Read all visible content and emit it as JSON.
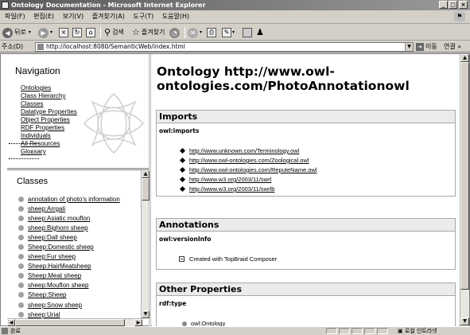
{
  "window": {
    "title": "Ontology Documentation - Microsoft Internet Explorer",
    "controls": [
      "_",
      "□",
      "×"
    ]
  },
  "menu": {
    "items": [
      "파일(F)",
      "편집(E)",
      "보기(V)",
      "즐겨찾기(A)",
      "도구(T)",
      "도움말(H)"
    ]
  },
  "toolbar": {
    "back_label": "뒤로",
    "search_label": "검색",
    "favorites_label": "즐겨찾기"
  },
  "address": {
    "label": "주소(D)",
    "url": "http://localhost:8080/SemanticWeb/index.html",
    "go_label": "이동",
    "links_label": "연결 »"
  },
  "nav": {
    "title": "Navigation",
    "items": [
      "Ontologies",
      "Class Hierarchy",
      "Classes",
      "Datatype Properties",
      "Object Properties",
      "RDF Properties",
      "Individuals",
      "All Resources",
      "Glossary"
    ]
  },
  "classes": {
    "title": "Classes",
    "items": [
      "annotation of photo's information",
      "sheep:Arrgali",
      "sheep:Asiatic mouflon",
      "sheep:Bighorn sheep",
      "sheep:Dall sheep",
      "Sheep:Domestic sheep",
      "sheep:Fur sheep",
      "Sheep:HairMeatsheep",
      "Sheep:Meat sheep",
      "sheep:Mouflon sheep",
      "Sheep:Sheep",
      "sheep:Snow sheep",
      "sheep:Urial"
    ]
  },
  "main": {
    "title": "Ontology http://www.owl-ontologies.com/PhotoAnnotationowl",
    "imports": {
      "heading": "Imports",
      "property": "owl:imports",
      "links": [
        "http://www.unknown.com/Terminology.owl",
        "http://www.owl-ontologies.com/Zoological.owl",
        "http://www.owl-ontologies.com/ReputeName.owl",
        "http://www.w3.org/2003/11/swrl",
        "http://www.w3.org/2003/11/swrlb"
      ]
    },
    "annotations": {
      "heading": "Annotations",
      "property": "owl:versionInfo",
      "value": "Created with TopBraid Composer"
    },
    "other": {
      "heading": "Other Properties",
      "property": "rdf:type",
      "value": "owl:Ontology"
    }
  },
  "status": {
    "text": "완료",
    "zone": "로컬 인트라넷"
  }
}
